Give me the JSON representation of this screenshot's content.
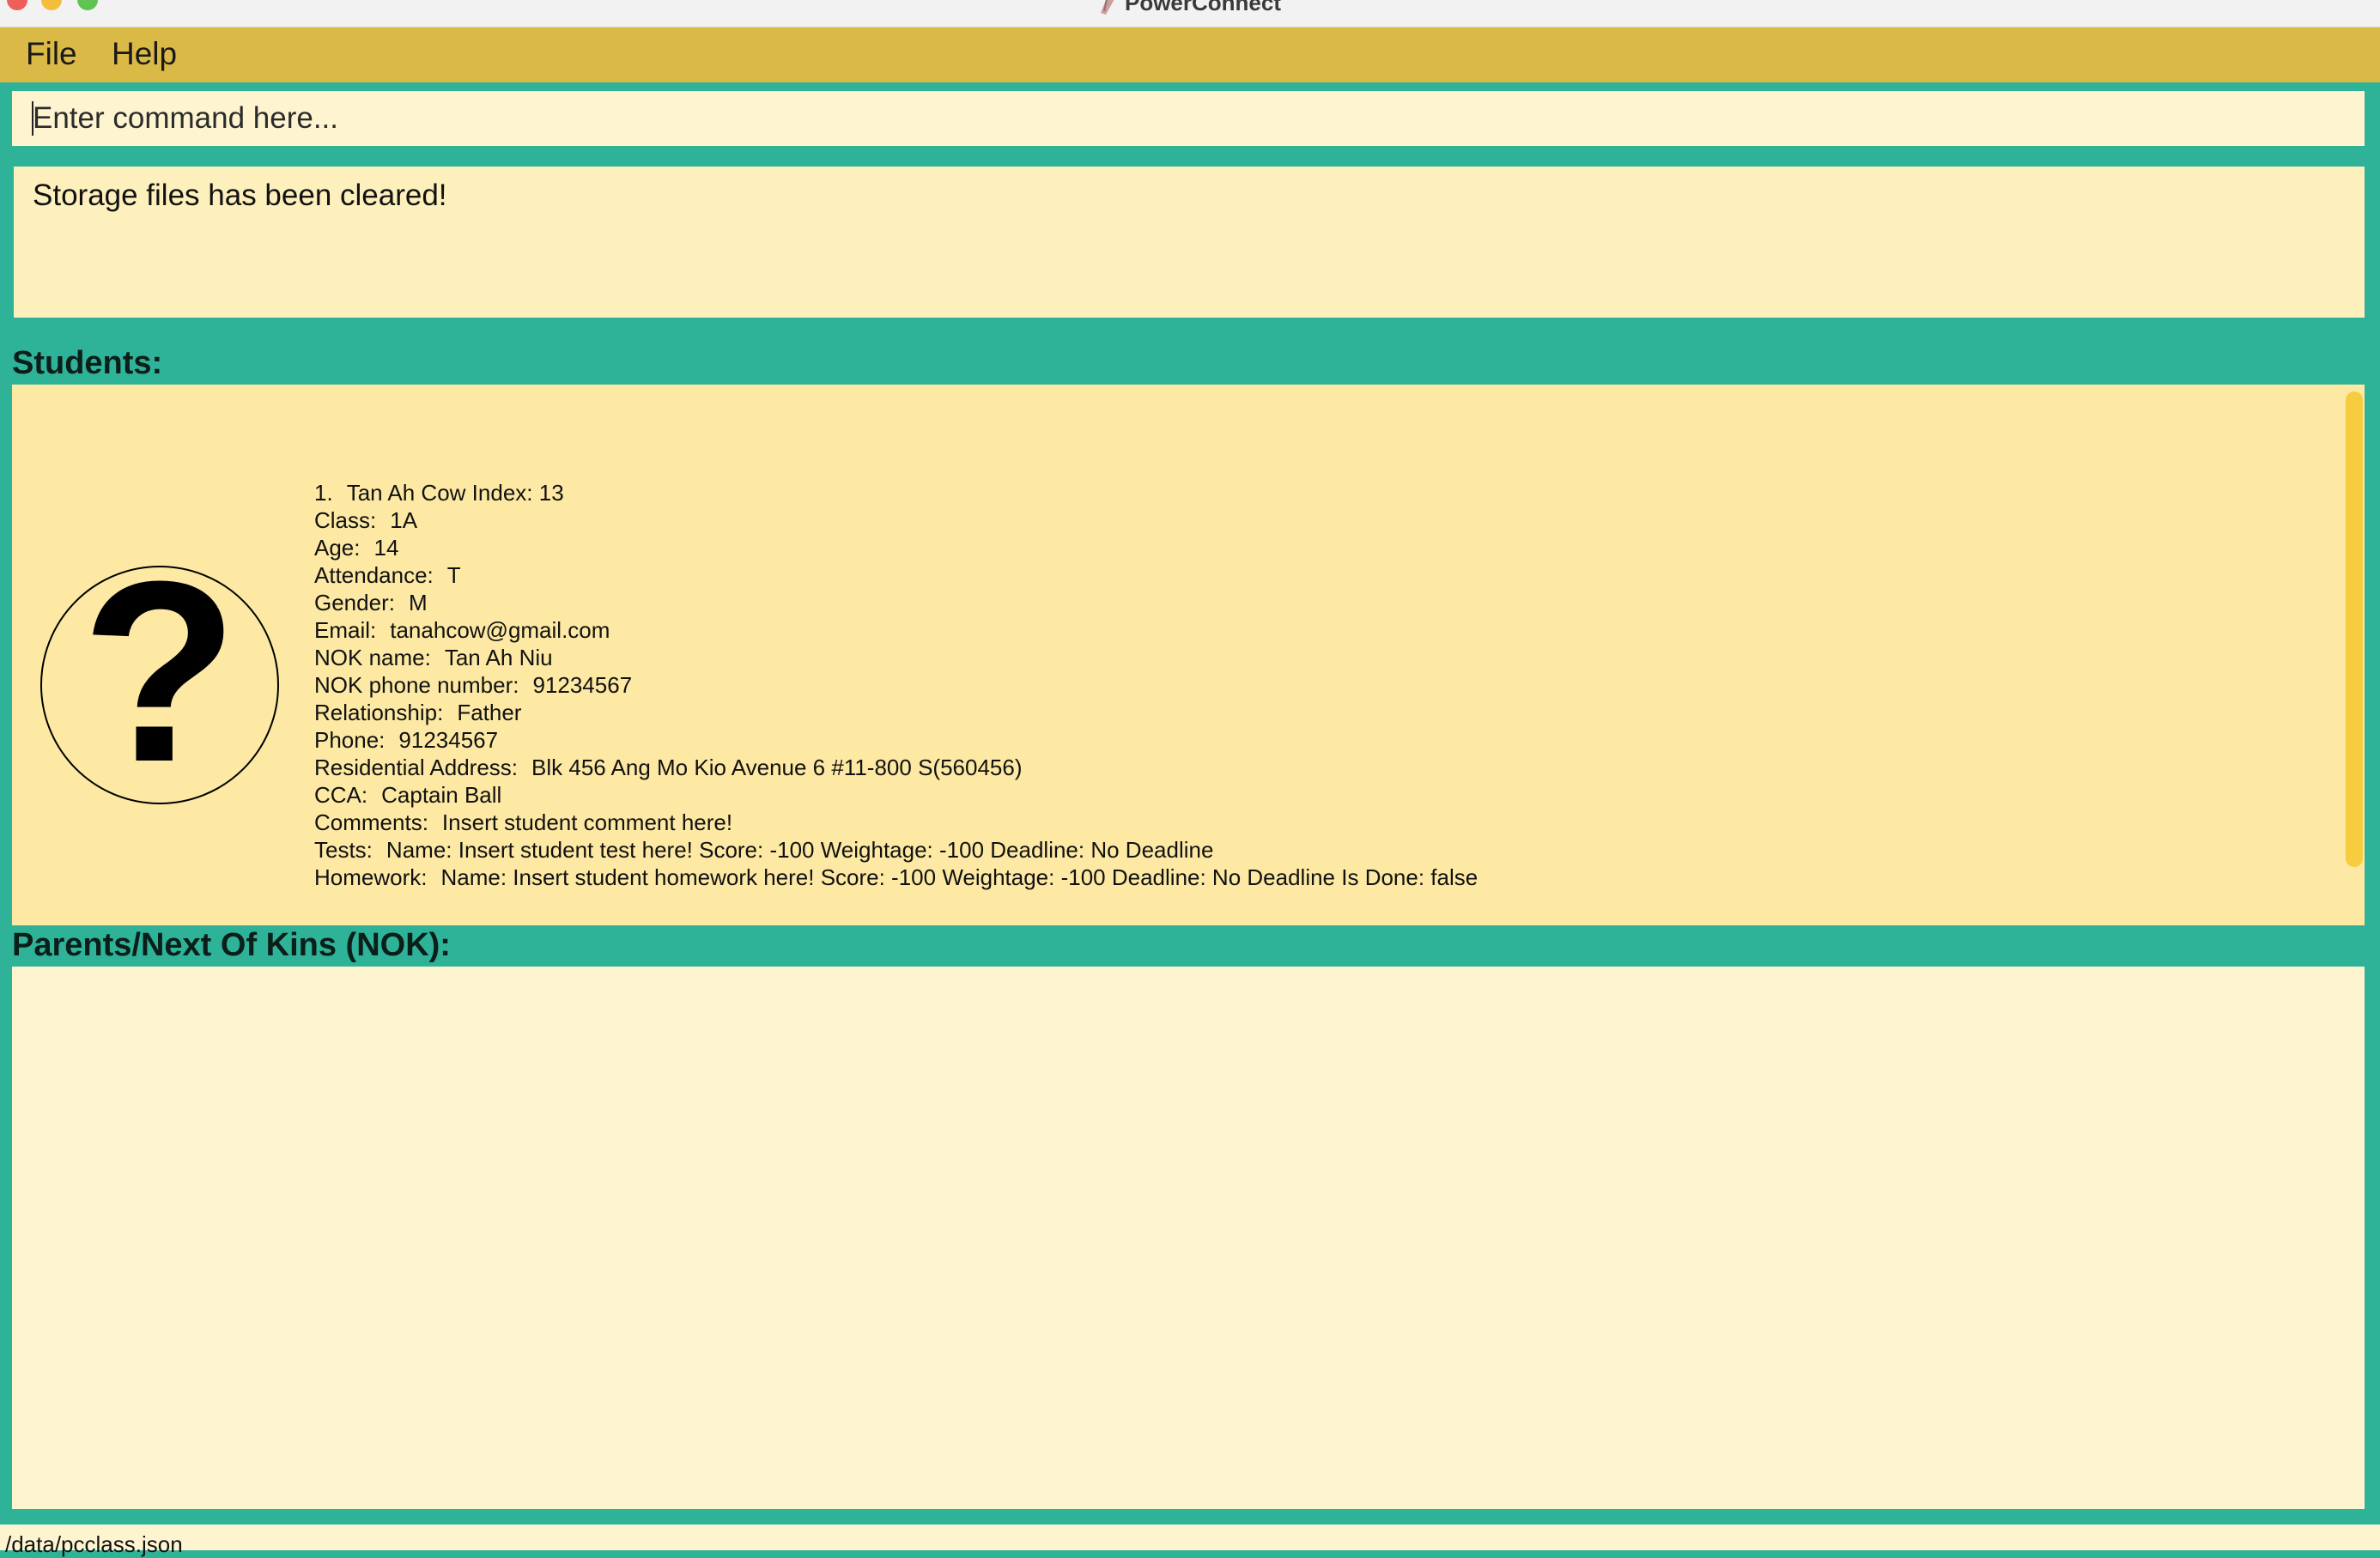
{
  "window": {
    "title": "PowerConnect"
  },
  "menu": {
    "file": "File",
    "help": "Help"
  },
  "command": {
    "placeholder": "Enter command here...",
    "value": ""
  },
  "result": {
    "message": "Storage files has been cleared!"
  },
  "students": {
    "heading": "Students:",
    "list": [
      {
        "number": "1.",
        "name": "Tan Ah Cow",
        "index_label": "Index:",
        "index": "13",
        "class_label": "Class:",
        "class": "1A",
        "age_label": "Age:",
        "age": "14",
        "attendance_label": "Attendance:",
        "attendance": "T",
        "gender_label": "Gender:",
        "gender": "M",
        "email_label": "Email:",
        "email": "tanahcow@gmail.com",
        "nok_name_label": "NOK name:",
        "nok_name": "Tan Ah Niu",
        "nok_phone_label": "NOK phone number:",
        "nok_phone": "91234567",
        "relationship_label": "Relationship:",
        "relationship": "Father",
        "phone_label": "Phone:",
        "phone": "91234567",
        "address_label": "Residential Address:",
        "address": "Blk 456 Ang Mo Kio Avenue 6 #11-800 S(560456)",
        "cca_label": "CCA:",
        "cca": "Captain Ball",
        "comments_label": "Comments:",
        "comments": "Insert student comment here!",
        "tests_label": "Tests:",
        "tests": "Name: Insert student test here! Score: -100 Weightage: -100 Deadline: No Deadline",
        "homework_label": "Homework:",
        "homework": "Name: Insert student homework here! Score: -100 Weightage: -100 Deadline: No Deadline Is Done: false"
      }
    ]
  },
  "parents": {
    "heading": "Parents/Next Of Kins (NOK):"
  },
  "status": {
    "path": "/data/pcclass.json"
  },
  "colors": {
    "background": "#2eb398",
    "menubar": "#dbb947",
    "panel": "#fde9a3",
    "input": "#fef5d0",
    "scrollbar": "#f7cc3f"
  }
}
